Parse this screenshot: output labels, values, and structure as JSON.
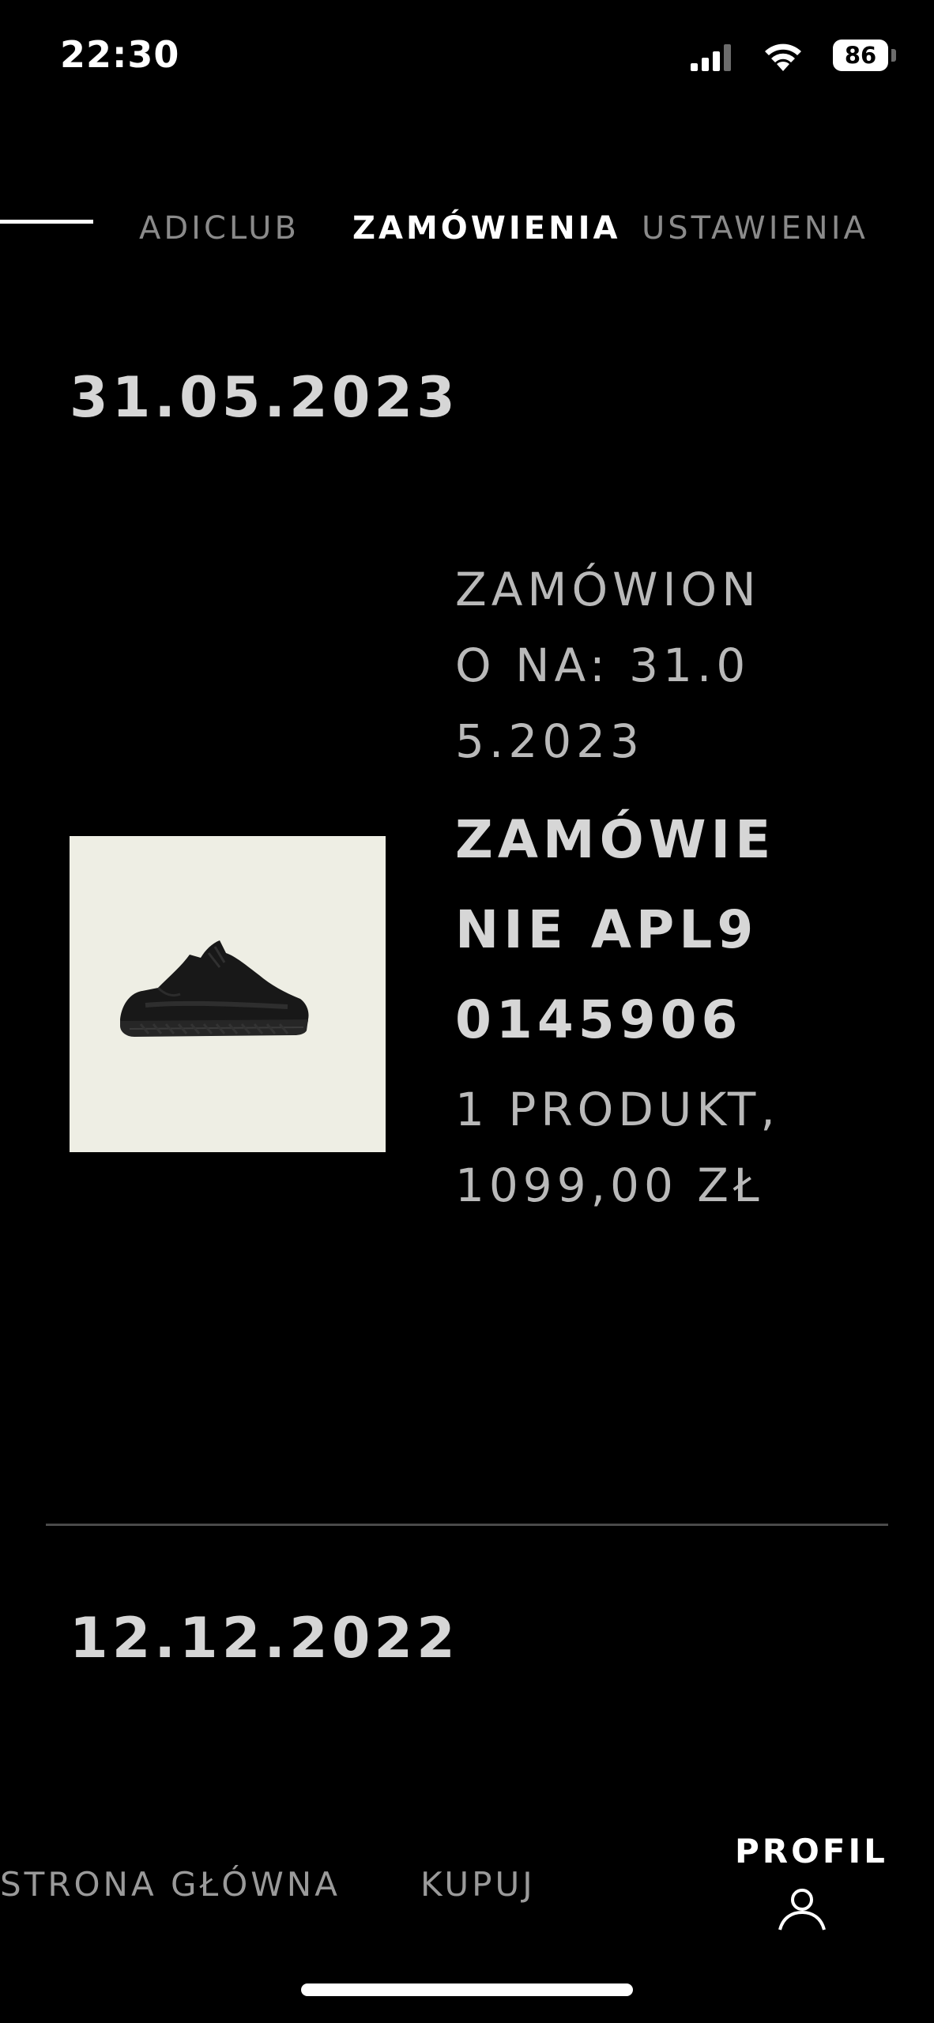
{
  "status_bar": {
    "time": "22:30",
    "battery": "86"
  },
  "tabs": [
    {
      "label": "ADICLUB",
      "active": false
    },
    {
      "label": "ZAMÓWIENIA",
      "active": true
    },
    {
      "label": "USTAWIENIA",
      "active": false
    }
  ],
  "orders": [
    {
      "date": "31.05.2023",
      "ordered_on": "ZAMÓWIONO NA: 31.05.2023",
      "order_number": "ZAMÓWIENIE APL90145906",
      "summary": "1 PRODUKT, 1099,00 ZŁ"
    },
    {
      "date": "12.12.2022"
    }
  ],
  "bottom_nav": {
    "home": "STRONA GŁÓWNA",
    "shop": "KUPUJ",
    "profile": "PROFIL"
  },
  "colors": {
    "background": "#000000",
    "active_text": "#ffffff",
    "inactive_text": "#8a8a8a",
    "product_bg": "#eeeee4"
  },
  "icons": [
    "signal-icon",
    "wifi-icon",
    "battery-icon",
    "sneaker-image",
    "profile-icon"
  ]
}
